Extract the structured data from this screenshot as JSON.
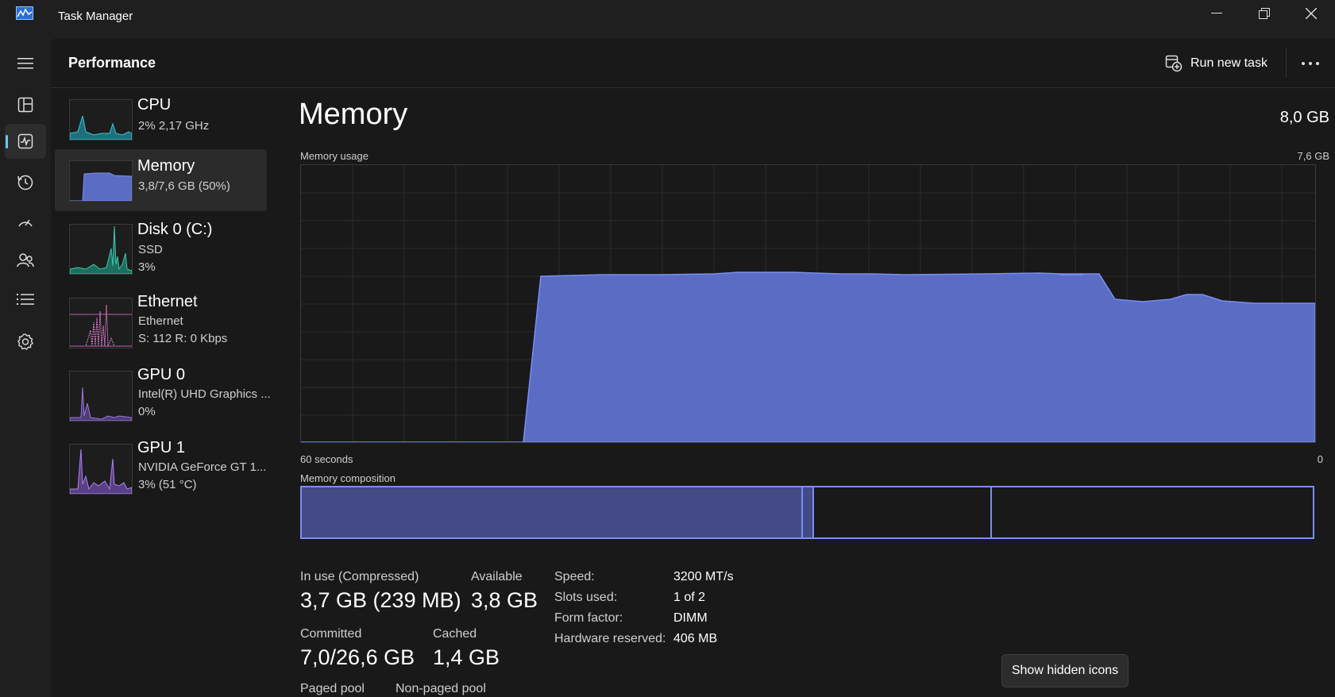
{
  "app": {
    "title": "Task Manager"
  },
  "header": {
    "title": "Performance",
    "run_task_label": "Run new task"
  },
  "sidebar": {
    "items": [
      {
        "title": "CPU",
        "line1": "2%  2,17 GHz",
        "line2": ""
      },
      {
        "title": "Memory",
        "line1": "3,8/7,6 GB (50%)",
        "line2": ""
      },
      {
        "title": "Disk 0 (C:)",
        "line1": "SSD",
        "line2": "3%"
      },
      {
        "title": "Ethernet",
        "line1": "Ethernet",
        "line2": "S: 112  R: 0 Kbps"
      },
      {
        "title": "GPU 0",
        "line1": "Intel(R) UHD Graphics ...",
        "line2": "0%"
      },
      {
        "title": "GPU 1",
        "line1": "NVIDIA GeForce GT 1...",
        "line2": "3%  (51 °C)"
      }
    ]
  },
  "memory": {
    "title": "Memory",
    "total": "8,0 GB",
    "usage_label": "Memory usage",
    "usage_max": "7,6 GB",
    "axis_left": "60 seconds",
    "axis_right": "0",
    "composition_label": "Memory composition"
  },
  "stats": {
    "in_use_label": "In use (Compressed)",
    "in_use_value": "3,7 GB (239 MB)",
    "available_label": "Available",
    "available_value": "3,8 GB",
    "committed_label": "Committed",
    "committed_value": "7,0/26,6 GB",
    "cached_label": "Cached",
    "cached_value": "1,4 GB",
    "paged_label": "Paged pool",
    "nonpaged_label": "Non-paged pool",
    "speed_label": "Speed:",
    "speed_value": "3200 MT/s",
    "slots_label": "Slots used:",
    "slots_value": "1 of 2",
    "form_label": "Form factor:",
    "form_value": "DIMM",
    "hwres_label": "Hardware reserved:",
    "hwres_value": "406 MB"
  },
  "tooltip": {
    "text": "Show hidden icons"
  },
  "colors": {
    "accent": "#60cdff",
    "memory_fill": "#5a6cc4",
    "memory_line": "#7b8ef0"
  },
  "icons": [
    "task-manager-icon",
    "minimize-icon",
    "restore-icon",
    "close-icon",
    "hamburger-icon",
    "processes-icon",
    "performance-icon",
    "app-history-icon",
    "startup-apps-icon",
    "users-icon",
    "details-icon",
    "services-icon",
    "run-task-icon",
    "more-icon"
  ]
}
